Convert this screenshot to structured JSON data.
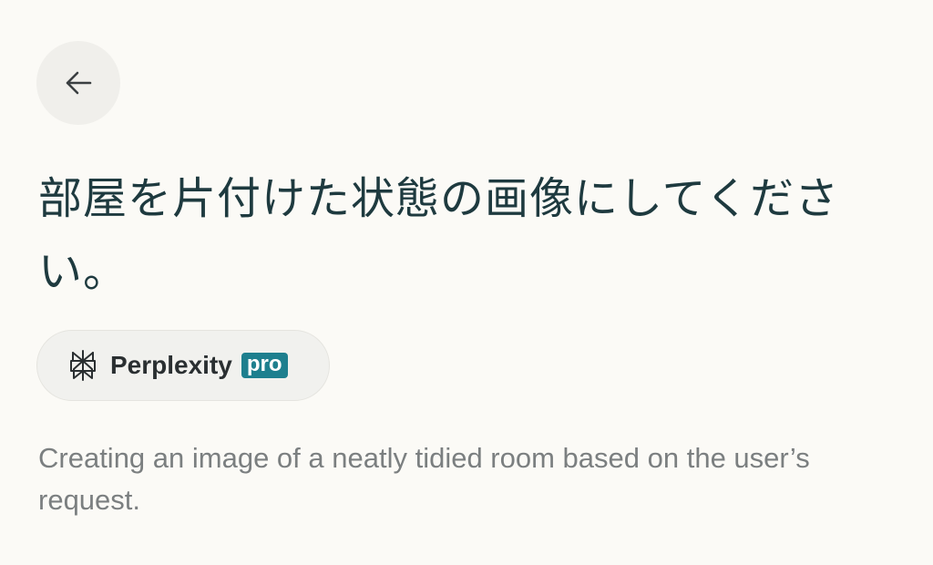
{
  "header": {
    "back_icon": "arrow-left-icon"
  },
  "query": {
    "title": "部屋を片付けた状態の画像にしてください。"
  },
  "model_chip": {
    "logo_icon": "perplexity-logo-icon",
    "name": "Perplexity",
    "badge": "pro",
    "badge_color": "#1e7f8e"
  },
  "status": {
    "text": "Creating an image of a neatly tidied room based on the user’s request."
  },
  "colors": {
    "background": "#fbfaf6",
    "title": "#1e3a3f",
    "status_text": "#7b7f80"
  }
}
